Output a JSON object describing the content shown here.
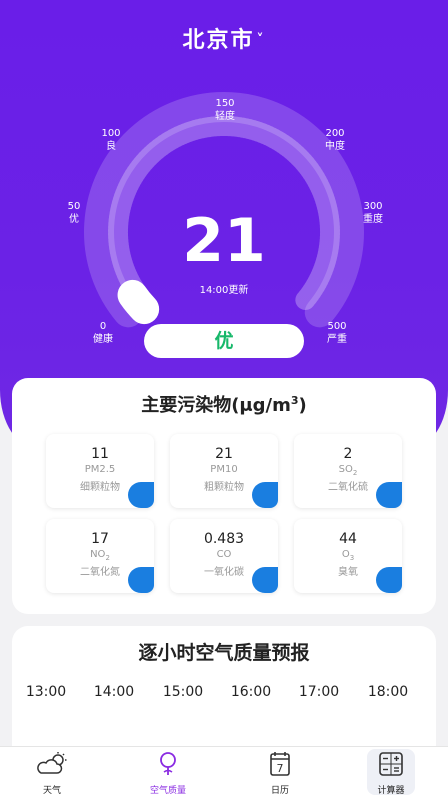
{
  "header": {
    "city": "北京市",
    "chevron": "˅"
  },
  "gauge": {
    "value": "21",
    "value_num": 21,
    "max": 500,
    "updated": "14:00更新",
    "level": "优",
    "level_color": "#17b86a",
    "ticks": [
      {
        "num": "0",
        "label": "健康"
      },
      {
        "num": "50",
        "label": "优"
      },
      {
        "num": "100",
        "label": "良"
      },
      {
        "num": "150",
        "label": "轻度"
      },
      {
        "num": "200",
        "label": "中度"
      },
      {
        "num": "300",
        "label": "重度"
      },
      {
        "num": "500",
        "label": "严重"
      }
    ]
  },
  "pollutants": {
    "title": "主要污染物(μg/m",
    "title_sup": "3",
    "title_end": ")",
    "items": [
      {
        "value": "11",
        "code": "PM2.5",
        "code_sub": "",
        "name": "细颗粒物"
      },
      {
        "value": "21",
        "code": "PM10",
        "code_sub": "",
        "name": "粗颗粒物"
      },
      {
        "value": "2",
        "code": "SO",
        "code_sub": "2",
        "name": "二氧化硫"
      },
      {
        "value": "17",
        "code": "NO",
        "code_sub": "2",
        "name": "二氧化氮"
      },
      {
        "value": "0.483",
        "code": "CO",
        "code_sub": "",
        "name": "一氧化碳"
      },
      {
        "value": "44",
        "code": "O",
        "code_sub": "3",
        "name": "臭氧"
      }
    ]
  },
  "forecast": {
    "title": "逐小时空气质量预报",
    "hours": [
      "13:00",
      "14:00",
      "15:00",
      "16:00",
      "17:00",
      "18:00"
    ]
  },
  "tabbar": {
    "tabs": [
      {
        "label": "天气",
        "icon": "weather-icon",
        "active": false
      },
      {
        "label": "空气质量",
        "icon": "air-quality-icon",
        "active": true
      },
      {
        "label": "日历",
        "icon": "calendar-icon",
        "active": false
      },
      {
        "label": "计算器",
        "icon": "calculator-icon",
        "active": false
      }
    ],
    "calendar_day": "7",
    "accent": "#8a2be2"
  },
  "colors": {
    "primary": "#6a1ee8",
    "drop": "#1a7ee0"
  }
}
